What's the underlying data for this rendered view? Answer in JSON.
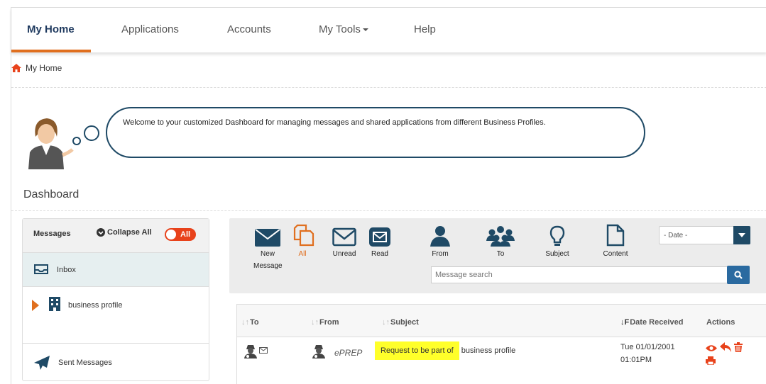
{
  "nav": {
    "items": [
      {
        "label": "My Home",
        "active": true
      },
      {
        "label": "Applications",
        "active": false
      },
      {
        "label": "Accounts",
        "active": false
      },
      {
        "label": "My Tools",
        "active": false,
        "dropdown": true
      },
      {
        "label": "Help",
        "active": false
      }
    ],
    "accent_color": "#e06f1f"
  },
  "breadcrumb": {
    "icon": "home-icon",
    "label": "My Home"
  },
  "welcome": {
    "text": "Welcome  to your customized Dashboard for managing messages and shared applications from different Business Profiles."
  },
  "dashboard": {
    "title": "Dashboard"
  },
  "messages_panel": {
    "title": "Messages",
    "collapse_label": "Collapse All",
    "toggle_label": "All",
    "inbox_label": "Inbox",
    "business_profile_label": "business profile",
    "sent_label": "Sent Messages"
  },
  "toolbar": {
    "new_label": "New",
    "new_label2": "Message",
    "all_label": "All",
    "unread_label": "Unread",
    "read_label": "Read",
    "from_label": "From",
    "to_label": "To",
    "subject_label": "Subject",
    "content_label": "Content",
    "date_select": "- Date -",
    "search_placeholder": "Message search"
  },
  "table": {
    "headers": {
      "to": "To",
      "from": "From",
      "subject": "Subject",
      "date": "Date Received",
      "actions": "Actions"
    },
    "rows": [
      {
        "from": "ePREP",
        "subject_highlight": "Request to be part of",
        "subject_rest": " business profile",
        "date_line1": "Tue 01/01/2001",
        "date_line2": "01:01PM"
      }
    ]
  },
  "colors": {
    "primary": "#1f4a66",
    "accent": "#e06f1f",
    "danger": "#e8421b",
    "highlight": "#ffff2a"
  }
}
